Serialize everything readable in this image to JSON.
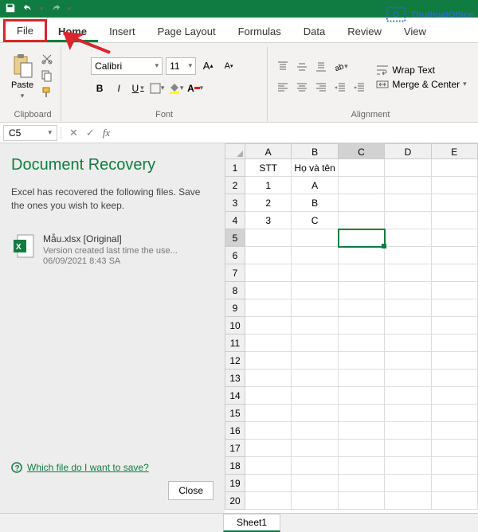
{
  "qat": {
    "save": "save-icon",
    "undo": "undo-icon",
    "redo": "redo-icon"
  },
  "watermark": "ThuthuatOffice",
  "tabs": {
    "file": "File",
    "home": "Home",
    "insert": "Insert",
    "page_layout": "Page Layout",
    "formulas": "Formulas",
    "data": "Data",
    "review": "Review",
    "view": "View"
  },
  "ribbon": {
    "clipboard": {
      "paste": "Paste",
      "label": "Clipboard"
    },
    "font": {
      "name": "Calibri",
      "size": "11",
      "label": "Font",
      "bold": "B",
      "italic": "I",
      "underline": "U"
    },
    "alignment": {
      "label": "Alignment",
      "wrap": "Wrap Text",
      "merge": "Merge & Center"
    }
  },
  "name_box": "C5",
  "fx": {
    "cancel": "✕",
    "enter": "✓",
    "fx": "fx"
  },
  "recovery": {
    "title": "Document Recovery",
    "subtitle": "Excel has recovered the following files.  Save the ones you wish to keep.",
    "item": {
      "name": "Mẫu.xlsx  [Original]",
      "line1": "Version created last time the use...",
      "line2": "06/09/2021 8:43 SA"
    },
    "help_link": "Which file do I want to save?",
    "close": "Close"
  },
  "grid": {
    "columns": [
      "A",
      "B",
      "C",
      "D",
      "E"
    ],
    "rows": [
      "1",
      "2",
      "3",
      "4",
      "5",
      "6",
      "7",
      "8",
      "9",
      "10",
      "11",
      "12",
      "13",
      "14",
      "15",
      "16",
      "17",
      "18",
      "19",
      "20"
    ],
    "data": {
      "A1": "STT",
      "B1": "Họ và tên",
      "A2": "1",
      "B2": "A",
      "A3": "2",
      "B3": "B",
      "A4": "3",
      "B4": "C"
    },
    "active": "C5"
  },
  "sheet": "Sheet1"
}
